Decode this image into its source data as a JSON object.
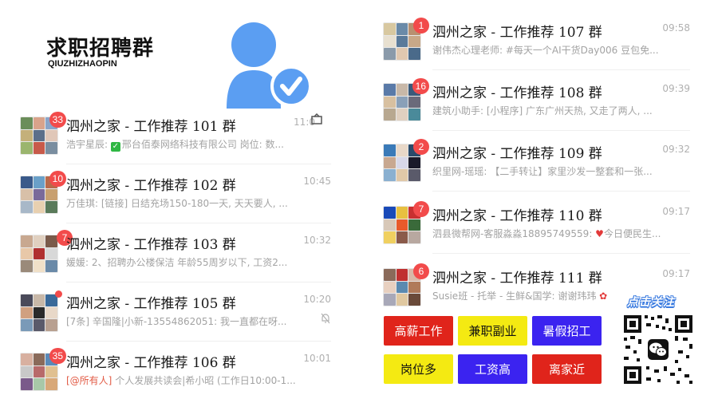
{
  "header": {
    "title": "求职招聘群",
    "subtitle": "QIUZHIZHAOPIN"
  },
  "colors": {
    "accent_blue": "#5b9ef2",
    "badge_red": "#f24b4b"
  },
  "chats": [
    {
      "title": "泗州之家 - 工作推荐 101 群",
      "time": "11:0",
      "badge": "33",
      "preview_name": "浩宇星辰: ",
      "preview_icon": "check-square-icon",
      "preview_text": "邢台佰泰网络科技有限公司 岗位: 数..."
    },
    {
      "title": "泗州之家 - 工作推荐 102 群",
      "time": "10:45",
      "badge": "10",
      "preview_text": "万佳琪: [链接] 日结充场150-180一天, 天天要人, ..."
    },
    {
      "title": "泗州之家 - 工作推荐 103 群",
      "time": "10:32",
      "badge": "7",
      "preview_text": "媛媛: 2、招聘办公楼保洁 年龄55周岁以下, 工资2..."
    },
    {
      "title": "泗州之家 - 工作推荐 105 群",
      "time": "10:20",
      "badge": "",
      "preview_text": "[7条] 辛国隆|小新-13554862051: 我一直都在呀..."
    },
    {
      "title": "泗州之家 - 工作推荐 106 群",
      "time": "10:01",
      "badge": "35",
      "preview_mention": "[@所有人]",
      "preview_text": " 个人发展共读会|希小昭 (工作日10:00-1..."
    },
    {
      "title": "泗州之家 - 工作推荐 107 群",
      "time": "09:58",
      "badge": "1",
      "preview_text": "谢伟杰心理老师: #每天一个AI干货Day006 豆包免..."
    },
    {
      "title": "泗州之家 - 工作推荐 108 群",
      "time": "09:39",
      "badge": "16",
      "preview_text": "建筑小助手: [小程序] 广东广州天热, 又走了两人, ..."
    },
    {
      "title": "泗州之家 - 工作推荐 109 群",
      "time": "09:32",
      "badge": "2",
      "preview_text": "织里网-瑶瑶: 【二手转让】家里沙发一整套和一张..."
    },
    {
      "title": "泗州之家 - 工作推荐 110 群",
      "time": "09:17",
      "badge": "7",
      "preview_name": "泗县微帮网-客服淼淼18895749559: ",
      "preview_icon": "heart-icon",
      "preview_text": "今日便民生..."
    },
    {
      "title": "泗州之家 - 工作推荐 111 群",
      "time": "09:17",
      "badge": "6",
      "preview_text": "Susie班 - 托举 - 生鲜&国学: 谢谢玮玮",
      "preview_icon": "rose-icon"
    }
  ],
  "buttons": [
    {
      "label": "高薪工作",
      "bg": "#e0241b",
      "fg": "#ffffff"
    },
    {
      "label": "兼职副业",
      "bg": "#f4ea12",
      "fg": "#111111"
    },
    {
      "label": "暑假招工",
      "bg": "#3b23f0",
      "fg": "#ffffff"
    },
    {
      "label": "岗位多",
      "bg": "#f4ea12",
      "fg": "#111111"
    },
    {
      "label": "工资高",
      "bg": "#3b23f0",
      "fg": "#ffffff"
    },
    {
      "label": "离家近",
      "bg": "#e0241b",
      "fg": "#ffffff"
    }
  ],
  "follow": {
    "label": "点击关注"
  }
}
